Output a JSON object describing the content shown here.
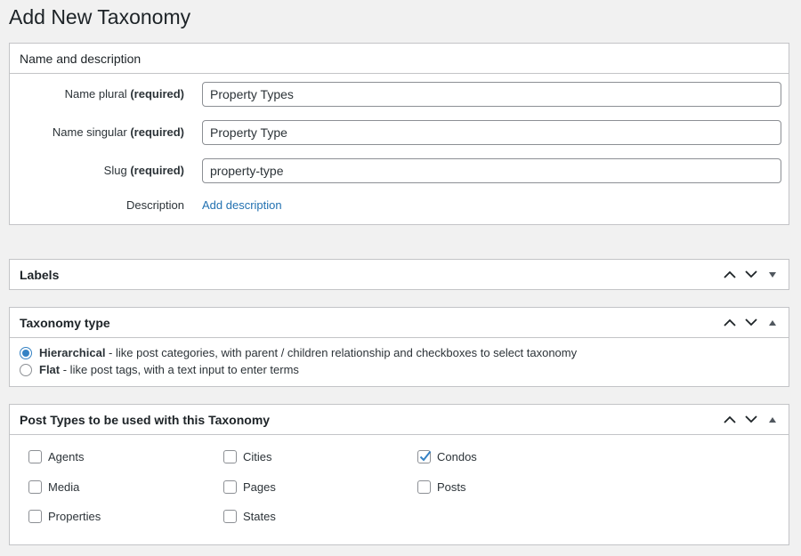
{
  "page": {
    "title": "Add New Taxonomy"
  },
  "name_box": {
    "heading": "Name and description",
    "plural": {
      "label": "Name plural",
      "required": "(required)",
      "value": "Property Types"
    },
    "singular": {
      "label": "Name singular",
      "required": "(required)",
      "value": "Property Type"
    },
    "slug": {
      "label": "Slug",
      "required": "(required)",
      "value": "property-type"
    },
    "description": {
      "label": "Description",
      "link": "Add description"
    }
  },
  "labels_box": {
    "heading": "Labels",
    "state": "collapsed"
  },
  "type_box": {
    "heading": "Taxonomy type",
    "options": [
      {
        "title": "Hierarchical",
        "desc": " - like post categories, with parent / children relationship and checkboxes to select taxonomy",
        "checked": true
      },
      {
        "title": "Flat",
        "desc": " - like post tags, with a text input to enter terms",
        "checked": false
      }
    ]
  },
  "post_types_box": {
    "heading": "Post Types to be used with this Taxonomy",
    "items": [
      {
        "label": "Agents",
        "checked": false
      },
      {
        "label": "Cities",
        "checked": false
      },
      {
        "label": "Condos",
        "checked": true
      },
      {
        "label": "Media",
        "checked": false
      },
      {
        "label": "Pages",
        "checked": false
      },
      {
        "label": "Posts",
        "checked": false
      },
      {
        "label": "Properties",
        "checked": false
      },
      {
        "label": "States",
        "checked": false
      }
    ]
  },
  "colors": {
    "link": "#2271b1",
    "radio": "#3582c4",
    "border": "#c3c4c7"
  },
  "icons": {
    "up": "chevron-up-icon",
    "down": "chevron-down-icon",
    "toggle_closed": "caret-down-icon",
    "toggle_open": "caret-up-icon"
  }
}
